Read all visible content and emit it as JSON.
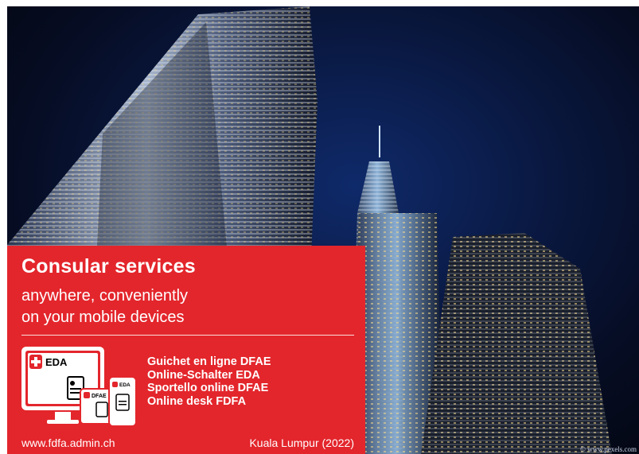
{
  "panel": {
    "title": "Consular services",
    "subtitle_line1": "anywhere, conveniently",
    "subtitle_line2": "on your mobile devices",
    "online_desks": [
      "Guichet en ligne DFAE",
      "Online-Schalter EDA",
      "Sportello online DFAE",
      "Online desk FDFA"
    ],
    "url": "www.fdfa.admin.ch",
    "location": "Kuala Lumpur (2022)"
  },
  "device_art": {
    "monitor_label": "EDA",
    "tablet_label": "DFAE",
    "phone_label": "EDA"
  },
  "photo": {
    "credit": "© www.pexels.com"
  },
  "colors": {
    "panel_red": "#e3262c",
    "night_sky": "#0a1a45"
  }
}
